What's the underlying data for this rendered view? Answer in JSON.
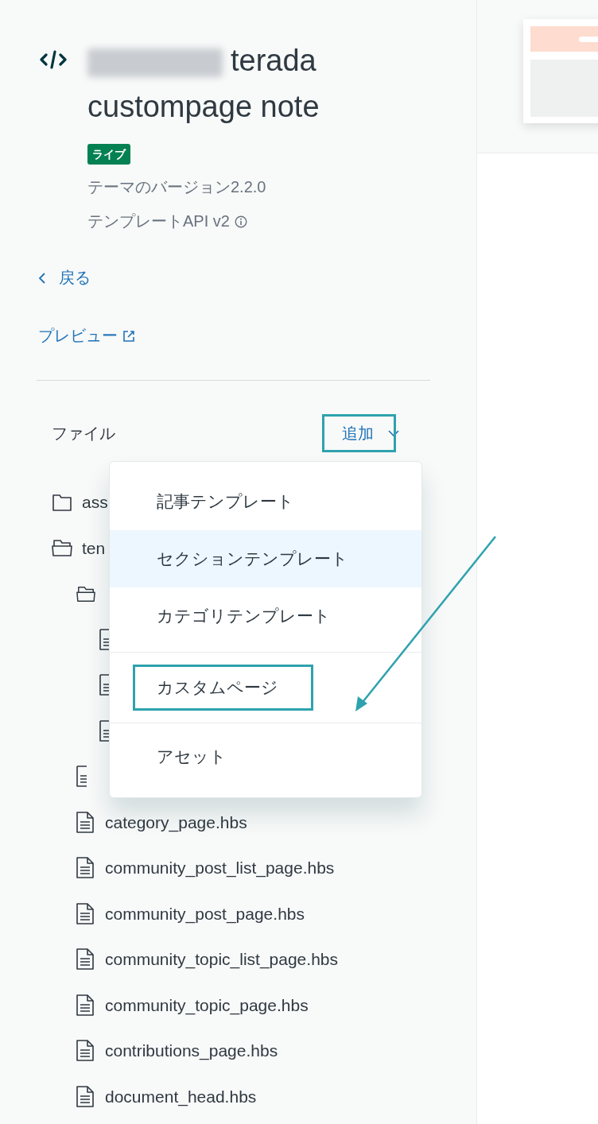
{
  "sidebar": {
    "title": "terada custompage note",
    "redacted": true,
    "status_badge": "ライブ",
    "theme_version": "テーマのバージョン2.2.0",
    "template_api": "テンプレートAPI v2",
    "back_link": "戻る",
    "preview_link": "プレビュー",
    "files": {
      "heading": "ファイル",
      "add_button": {
        "label": "追加",
        "annotated": true
      },
      "tree": [
        {
          "kind": "folder",
          "label": "ass",
          "expanded": false
        },
        {
          "kind": "folder",
          "label": "ten",
          "expanded": true,
          "children": [
            {
              "kind": "folder",
              "expanded": true,
              "children": [
                {
                  "kind": "file"
                },
                {
                  "kind": "file"
                },
                {
                  "kind": "file"
                }
              ]
            },
            {
              "kind": "file"
            },
            {
              "kind": "file",
              "label": "category_page.hbs"
            },
            {
              "kind": "file",
              "label": "community_post_list_page.hbs"
            },
            {
              "kind": "file",
              "label": "community_post_page.hbs"
            },
            {
              "kind": "file",
              "label": "community_topic_list_page.hbs"
            },
            {
              "kind": "file",
              "label": "community_topic_page.hbs"
            },
            {
              "kind": "file",
              "label": "contributions_page.hbs"
            },
            {
              "kind": "file",
              "label": "document_head.hbs"
            }
          ]
        }
      ]
    }
  },
  "add_menu": {
    "groups": [
      [
        {
          "label": "記事テンプレート",
          "selected": false,
          "annotated": false
        },
        {
          "label": "セクションテンプレート",
          "selected": true,
          "annotated": false
        },
        {
          "label": "カテゴリテンプレート",
          "selected": false,
          "annotated": false
        }
      ],
      [
        {
          "label": "カスタムページ",
          "selected": false,
          "annotated": true
        }
      ],
      [
        {
          "label": "アセット",
          "selected": false,
          "annotated": false
        }
      ]
    ]
  }
}
